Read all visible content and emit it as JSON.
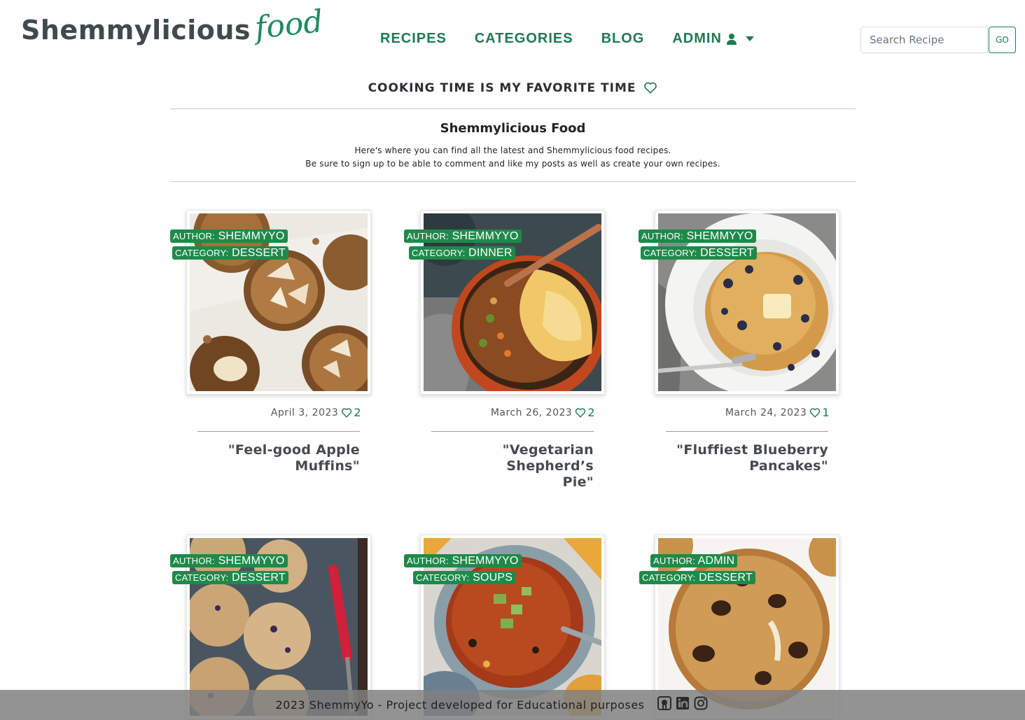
{
  "header": {
    "logo_main": "Shemmylicious",
    "logo_script": "food",
    "nav": [
      {
        "label": "RECIPES"
      },
      {
        "label": "CATEGORIES"
      },
      {
        "label": "BLOG"
      },
      {
        "label": "ADMIN"
      }
    ],
    "search": {
      "placeholder": "Search Recipe",
      "button_label": "GO"
    }
  },
  "tagline": "COOKING TIME IS MY FAVORITE TIME",
  "intro": {
    "title": "Shemmylicious Food",
    "line1": "Here's where you can find all the latest and Shemmylicious food recipes.",
    "line2": "Be sure to sign up to be able to comment and like my posts as well as create your own recipes."
  },
  "labels": {
    "author": "AUTHOR:",
    "category": "CATEGORY:"
  },
  "recipes": [
    {
      "author": "SHEMMYYO",
      "category": "DESSERT",
      "date": "April 3, 2023",
      "likes": "2",
      "title": "\"Feel-good Apple Muffins\"",
      "title_l1": "\"Feel-good Apple",
      "title_l2": "Muffins\"",
      "image": "muffins-photo"
    },
    {
      "author": "SHEMMYYO",
      "category": "DINNER",
      "date": "March 26, 2023",
      "likes": "2",
      "title": "\"Vegetarian Shepherd’s Pie\"",
      "title_l1": "\"Vegetarian Shepherd’s",
      "title_l2": "Pie\"",
      "image": "shepherds-pie-photo"
    },
    {
      "author": "SHEMMYYO",
      "category": "DESSERT",
      "date": "March 24, 2023",
      "likes": "1",
      "title": "\"Fluffiest Blueberry Pancakes\"",
      "title_l1": "\"Fluffiest Blueberry",
      "title_l2": "Pancakes\"",
      "image": "pancakes-photo"
    },
    {
      "author": "SHEMMYYO",
      "category": "DESSERT",
      "image": "blueberry-muffins-photo"
    },
    {
      "author": "SHEMMYYO",
      "category": "SOUPS",
      "image": "chili-soup-photo"
    },
    {
      "author": "ADMIN",
      "category": "DESSERT",
      "image": "cookie-photo"
    }
  ],
  "footer": {
    "text": "2023 ShemmyYo - Project developed for Educational purposes",
    "icons": [
      "github-icon",
      "linkedin-icon",
      "instagram-icon"
    ]
  },
  "colors": {
    "brand_green": "#1f7a52",
    "badge_green": "#1e8a4a",
    "footer_bg": "#808080"
  }
}
